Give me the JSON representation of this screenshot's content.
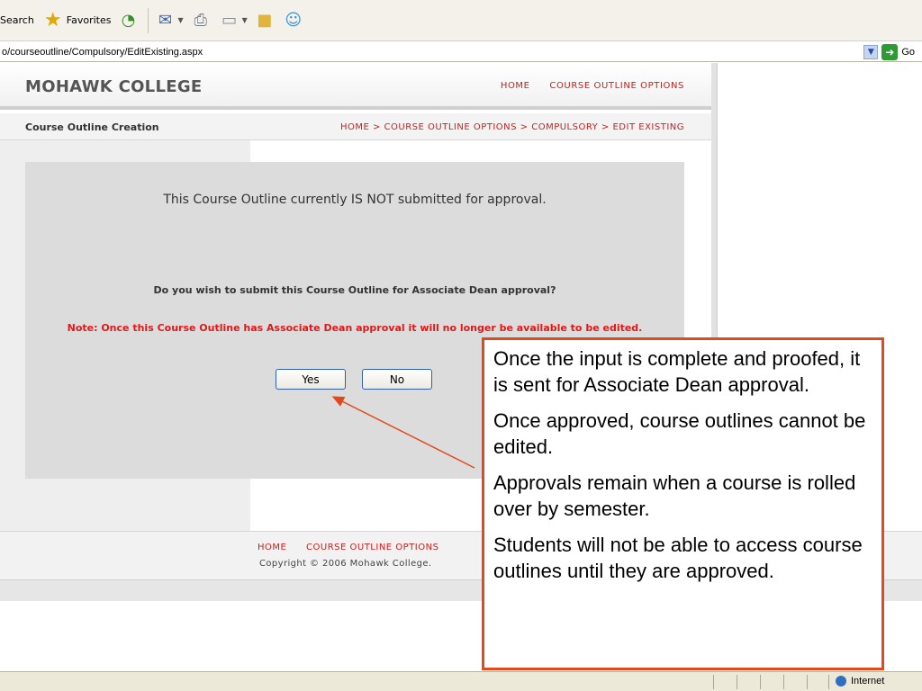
{
  "toolbar": {
    "search_label": "Search",
    "favorites_label": "Favorites",
    "icons": [
      "history-icon",
      "mail-icon",
      "print-icon",
      "edit-icon",
      "folder-icon",
      "messenger-icon"
    ]
  },
  "address": {
    "url": "o/courseoutline/Compulsory/EditExisting.aspx",
    "go_label": "Go"
  },
  "site": {
    "brand": "MOHAWK COLLEGE",
    "nav": [
      "HOME",
      "COURSE OUTLINE OPTIONS"
    ],
    "subtitle": "Course Outline Creation",
    "breadcrumb": "HOME > COURSE OUTLINE OPTIONS > COMPULSORY > EDIT EXISTING"
  },
  "panel": {
    "status_text": "This Course Outline currently IS NOT submitted for approval.",
    "question": "Do you wish to submit this Course Outline for Associate Dean approval?",
    "note": "Note: Once this Course Outline has Associate Dean approval it will no longer be available to be edited.",
    "yes_label": "Yes",
    "no_label": "No"
  },
  "footer": {
    "nav": [
      "HOME",
      "COURSE OUTLINE OPTIONS"
    ],
    "copyright": "Copyright © 2006 Mohawk College."
  },
  "statusbar": {
    "zone": "Internet"
  },
  "callout": {
    "paragraphs": [
      "Once the input is complete and proofed, it is sent for Associate Dean approval.",
      "Once approved, course outlines cannot be edited.",
      "Approvals remain when a course is rolled over by semester.",
      "Students will not be able to access course outlines until they are approved."
    ]
  },
  "colors": {
    "accent_red": "#c8201e",
    "note_red": "#e01818",
    "callout_border": "#e04a1e",
    "panel_bg": "#dcdcdc"
  }
}
